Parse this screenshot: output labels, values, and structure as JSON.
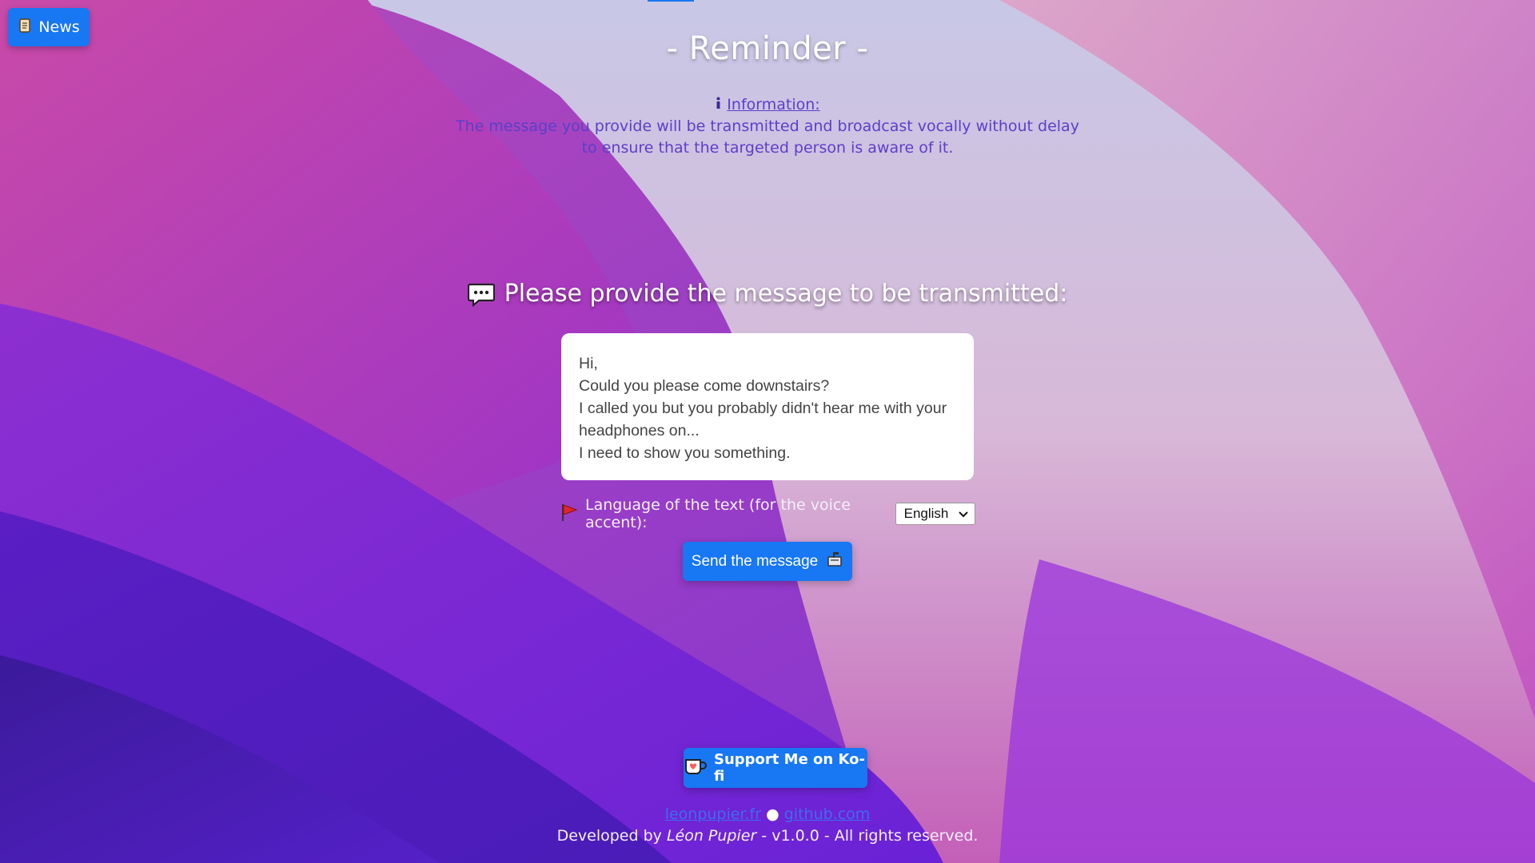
{
  "header": {
    "news_button_label": "News",
    "title": "- Reminder -"
  },
  "info": {
    "label": "Information:",
    "text": "The message you provide will be transmitted and broadcast vocally without delay to ensure that the targeted person is aware of it."
  },
  "prompt": {
    "text": "Please provide the message to be transmitted:"
  },
  "message": {
    "value": "Hi,\nCould you please come downstairs?\nI called you but you probably didn't hear me with your headphones on...\nI need to show you something."
  },
  "language": {
    "label": "Language of the text (for the voice accent):",
    "selected": "English"
  },
  "send_button": {
    "label": "Send the message"
  },
  "kofi": {
    "label": "Support Me on Ko-fi"
  },
  "links": {
    "site": "leonpupier.fr",
    "separator": "●",
    "github": "github.com"
  },
  "footer": {
    "prefix": "Developed by ",
    "author": "Léon Pupier",
    "suffix": " - v1.0.0 - All rights reserved."
  },
  "colors": {
    "accent": "#1877f2",
    "info_text": "#5c3fc8",
    "link": "#3d6cf0"
  },
  "icons": {
    "news": "scroll-icon",
    "info": "info-icon",
    "prompt": "speech-bubble-icon",
    "language": "red-flag-icon",
    "send": "mailbox-icon",
    "kofi": "ko-fi-cup-icon"
  }
}
